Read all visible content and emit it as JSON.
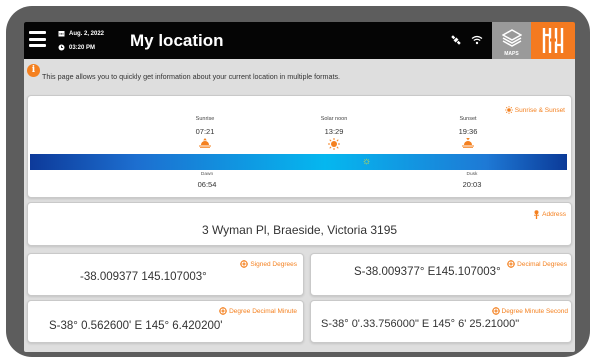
{
  "header": {
    "date": "Aug. 2, 2022",
    "time": "03:20 PM",
    "title": "My location",
    "maps_label": "MAPS"
  },
  "info": {
    "text": "This page allows you to quickly get information about your current location in multiple formats."
  },
  "sun": {
    "section_label": "Sunrise & Sunset",
    "sunrise_label": "Sunrise",
    "sunrise_time": "07:21",
    "noon_label": "Solar noon",
    "noon_time": "13:29",
    "sunset_label": "Sunset",
    "sunset_time": "19:36",
    "dawn_label": "Dawn",
    "dawn_time": "06:54",
    "dusk_label": "Dusk",
    "dusk_time": "20:03",
    "current_sun_marker": "☼"
  },
  "address": {
    "label": "Address",
    "value": "3 Wyman Pl, Braeside, Victoria 3195"
  },
  "coords": {
    "signed": {
      "label": "Signed Degrees",
      "value": "-38.009377 145.107003°"
    },
    "decimal": {
      "label": "Decimal Degrees",
      "value": "S-38.009377° E145.107003°"
    },
    "ddm": {
      "label": "Degree Decimal Minute",
      "value": "S-38° 0.562600' E 145° 6.420200'"
    },
    "dms": {
      "label": "Degree Minute Second",
      "value": "S-38° 0'.33.756000\" E 145° 6' 25.21000\""
    }
  },
  "colors": {
    "accent": "#f4801f",
    "topbar": "#050505",
    "maps_bg": "#9a9a9a",
    "logo_bg": "#f47a20"
  }
}
